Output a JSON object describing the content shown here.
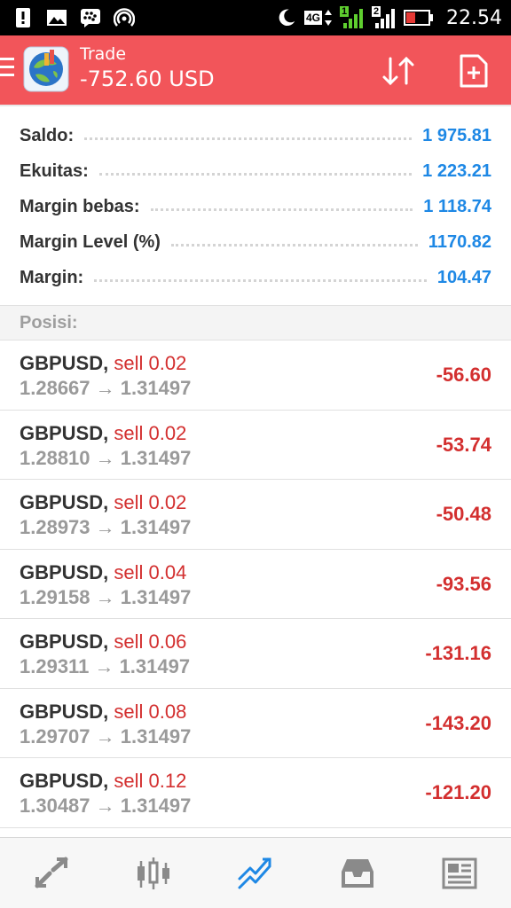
{
  "status_bar": {
    "time": "22.54",
    "network": "4G",
    "sim1": "1",
    "sim2": "2"
  },
  "header": {
    "title": "Trade",
    "subtitle": "-752.60 USD",
    "background_color": "#f2555a"
  },
  "summary": [
    {
      "label": "Saldo:",
      "value": "1 975.81"
    },
    {
      "label": "Ekuitas:",
      "value": "1 223.21"
    },
    {
      "label": "Margin bebas:",
      "value": "1 118.74"
    },
    {
      "label": "Margin Level (%)",
      "value": "1170.82"
    },
    {
      "label": "Margin:",
      "value": "104.47"
    }
  ],
  "positions_header": "Posisi:",
  "positions": [
    {
      "symbol": "GBPUSD,",
      "direction": "sell 0.02",
      "open_price": "1.28667",
      "arrow": "→",
      "current_price": "1.31497",
      "profit": "-56.60"
    },
    {
      "symbol": "GBPUSD,",
      "direction": "sell 0.02",
      "open_price": "1.28810",
      "arrow": "→",
      "current_price": "1.31497",
      "profit": "-53.74"
    },
    {
      "symbol": "GBPUSD,",
      "direction": "sell 0.02",
      "open_price": "1.28973",
      "arrow": "→",
      "current_price": "1.31497",
      "profit": "-50.48"
    },
    {
      "symbol": "GBPUSD,",
      "direction": "sell 0.04",
      "open_price": "1.29158",
      "arrow": "→",
      "current_price": "1.31497",
      "profit": "-93.56"
    },
    {
      "symbol": "GBPUSD,",
      "direction": "sell 0.06",
      "open_price": "1.29311",
      "arrow": "→",
      "current_price": "1.31497",
      "profit": "-131.16"
    },
    {
      "symbol": "GBPUSD,",
      "direction": "sell 0.08",
      "open_price": "1.29707",
      "arrow": "→",
      "current_price": "1.31497",
      "profit": "-143.20"
    },
    {
      "symbol": "GBPUSD,",
      "direction": "sell 0.12",
      "open_price": "1.30487",
      "arrow": "→",
      "current_price": "1.31497",
      "profit": "-121.20"
    }
  ],
  "bottom_nav": [
    {
      "icon": "quotes-icon",
      "active": false
    },
    {
      "icon": "chart-icon",
      "active": false
    },
    {
      "icon": "trade-icon",
      "active": true
    },
    {
      "icon": "history-icon",
      "active": false
    },
    {
      "icon": "news-icon",
      "active": false
    }
  ],
  "colors": {
    "accent_blue": "#1e88e5",
    "loss_red": "#d32f2f",
    "header_red": "#f2555a"
  }
}
